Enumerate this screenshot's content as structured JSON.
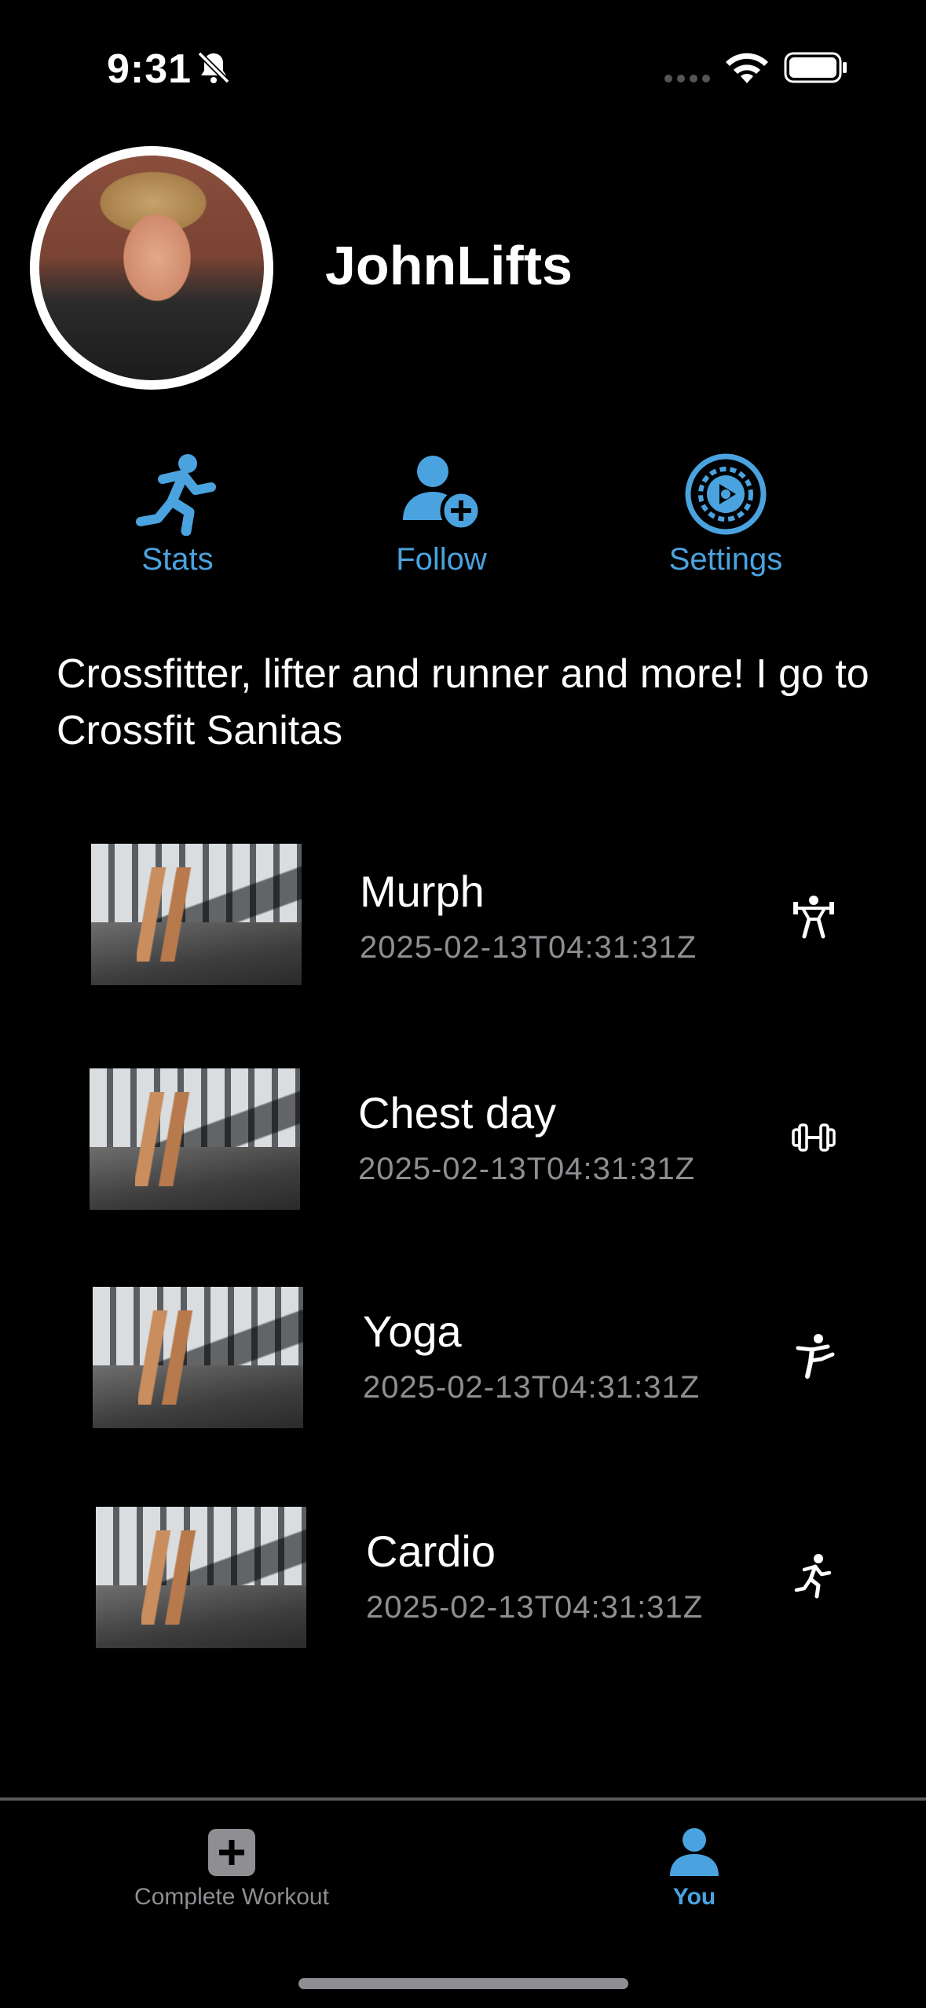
{
  "status_bar": {
    "time": "9:31"
  },
  "profile": {
    "username": "JohnLifts",
    "bio": "Crossfitter, lifter and runner and more! I go to Crossfit Sanitas"
  },
  "actions": [
    {
      "label": "Stats",
      "icon": "running-figure-icon"
    },
    {
      "label": "Follow",
      "icon": "person-add-icon"
    },
    {
      "label": "Settings",
      "icon": "gear-icon"
    }
  ],
  "workouts": [
    {
      "title": "Murph",
      "date": "2025-02-13T04:31:31Z",
      "icon": "weightlifter-icon"
    },
    {
      "title": "Chest day",
      "date": "2025-02-13T04:31:31Z",
      "icon": "dumbbell-icon"
    },
    {
      "title": "Yoga",
      "date": "2025-02-13T04:31:31Z",
      "icon": "kick-figure-icon"
    },
    {
      "title": "Cardio",
      "date": "2025-02-13T04:31:31Z",
      "icon": "runner-icon"
    }
  ],
  "tab_bar": [
    {
      "label": "Complete Workout",
      "icon": "plus-square-icon",
      "active": false
    },
    {
      "label": "You",
      "icon": "person-icon",
      "active": true
    }
  ],
  "colors": {
    "accent": "#4aa3df",
    "background": "#000000",
    "secondary_text": "#8e8e93"
  }
}
